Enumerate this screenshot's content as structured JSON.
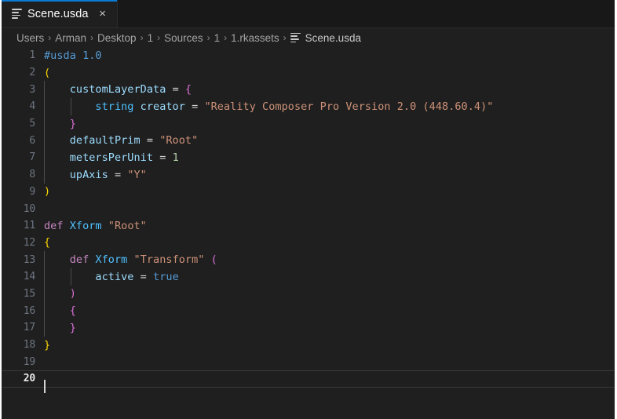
{
  "window": {
    "accent_color": "#0a7ad4",
    "background": "#1f1f1f",
    "tabbar_background": "#181818"
  },
  "tabbar": {
    "tabs": [
      {
        "label": "Scene.usda",
        "icon": "usd-file-icon",
        "close_label": "×",
        "active": true
      }
    ]
  },
  "breadcrumb": {
    "separator": "›",
    "items": [
      "Users",
      "Arman",
      "Desktop",
      "1",
      "Sources",
      "1",
      "1.rkassets"
    ],
    "final": {
      "label": "Scene.usda",
      "icon": "usd-file-icon"
    }
  },
  "editor": {
    "language": "usda",
    "current_line": 20,
    "total_lines": 20,
    "lines": [
      {
        "n": "1",
        "guides": 0,
        "tokens": [
          {
            "text": "#usda ",
            "cls": "t-comment"
          },
          {
            "text": "1.0",
            "cls": "t-num"
          }
        ]
      },
      {
        "n": "2",
        "guides": 0,
        "tokens": [
          {
            "text": "(",
            "cls": "t-paren-yg"
          }
        ]
      },
      {
        "n": "3",
        "guides": 1,
        "tokens": [
          {
            "text": "    customLayerData ",
            "cls": "t-prop"
          },
          {
            "text": "= ",
            "cls": "t-op"
          },
          {
            "text": "{",
            "cls": "t-brace"
          }
        ]
      },
      {
        "n": "4",
        "guides": 2,
        "tokens": [
          {
            "text": "        string ",
            "cls": "t-type"
          },
          {
            "text": "creator ",
            "cls": "t-prop"
          },
          {
            "text": "= ",
            "cls": "t-op"
          },
          {
            "text": "\"Reality Composer Pro Version 2.0 (448.60.4)\"",
            "cls": "t-str"
          }
        ]
      },
      {
        "n": "5",
        "guides": 1,
        "tokens": [
          {
            "text": "    }",
            "cls": "t-brace"
          }
        ]
      },
      {
        "n": "6",
        "guides": 1,
        "tokens": [
          {
            "text": "    defaultPrim ",
            "cls": "t-prop"
          },
          {
            "text": "= ",
            "cls": "t-op"
          },
          {
            "text": "\"Root\"",
            "cls": "t-str"
          }
        ]
      },
      {
        "n": "7",
        "guides": 1,
        "tokens": [
          {
            "text": "    metersPerUnit ",
            "cls": "t-prop"
          },
          {
            "text": "= ",
            "cls": "t-op"
          },
          {
            "text": "1",
            "cls": "t-numlit"
          }
        ]
      },
      {
        "n": "8",
        "guides": 1,
        "tokens": [
          {
            "text": "    upAxis ",
            "cls": "t-prop"
          },
          {
            "text": "= ",
            "cls": "t-op"
          },
          {
            "text": "\"Y\"",
            "cls": "t-str"
          }
        ]
      },
      {
        "n": "9",
        "guides": 0,
        "tokens": [
          {
            "text": ")",
            "cls": "t-paren-yg"
          }
        ]
      },
      {
        "n": "10",
        "guides": 0,
        "tokens": []
      },
      {
        "n": "11",
        "guides": 0,
        "tokens": [
          {
            "text": "def ",
            "cls": "t-kw"
          },
          {
            "text": "Xform ",
            "cls": "t-type"
          },
          {
            "text": "\"Root\"",
            "cls": "t-str"
          }
        ]
      },
      {
        "n": "12",
        "guides": 0,
        "tokens": [
          {
            "text": "{",
            "cls": "t-paren-yg"
          }
        ]
      },
      {
        "n": "13",
        "guides": 1,
        "tokens": [
          {
            "text": "    def ",
            "cls": "t-kw"
          },
          {
            "text": "Xform ",
            "cls": "t-type"
          },
          {
            "text": "\"Transform\" ",
            "cls": "t-str"
          },
          {
            "text": "(",
            "cls": "t-brace"
          }
        ]
      },
      {
        "n": "14",
        "guides": 2,
        "tokens": [
          {
            "text": "        active ",
            "cls": "t-prop"
          },
          {
            "text": "= ",
            "cls": "t-op"
          },
          {
            "text": "true",
            "cls": "t-bool"
          }
        ]
      },
      {
        "n": "15",
        "guides": 1,
        "tokens": [
          {
            "text": "    )",
            "cls": "t-brace"
          }
        ]
      },
      {
        "n": "16",
        "guides": 1,
        "tokens": [
          {
            "text": "    {",
            "cls": "t-brace"
          }
        ]
      },
      {
        "n": "17",
        "guides": 1,
        "tokens": [
          {
            "text": "    }",
            "cls": "t-brace"
          }
        ]
      },
      {
        "n": "18",
        "guides": 0,
        "tokens": [
          {
            "text": "}",
            "cls": "t-paren-yg"
          }
        ]
      },
      {
        "n": "19",
        "guides": 0,
        "tokens": []
      },
      {
        "n": "20",
        "guides": 0,
        "current": true,
        "caret": true,
        "tokens": []
      }
    ]
  }
}
